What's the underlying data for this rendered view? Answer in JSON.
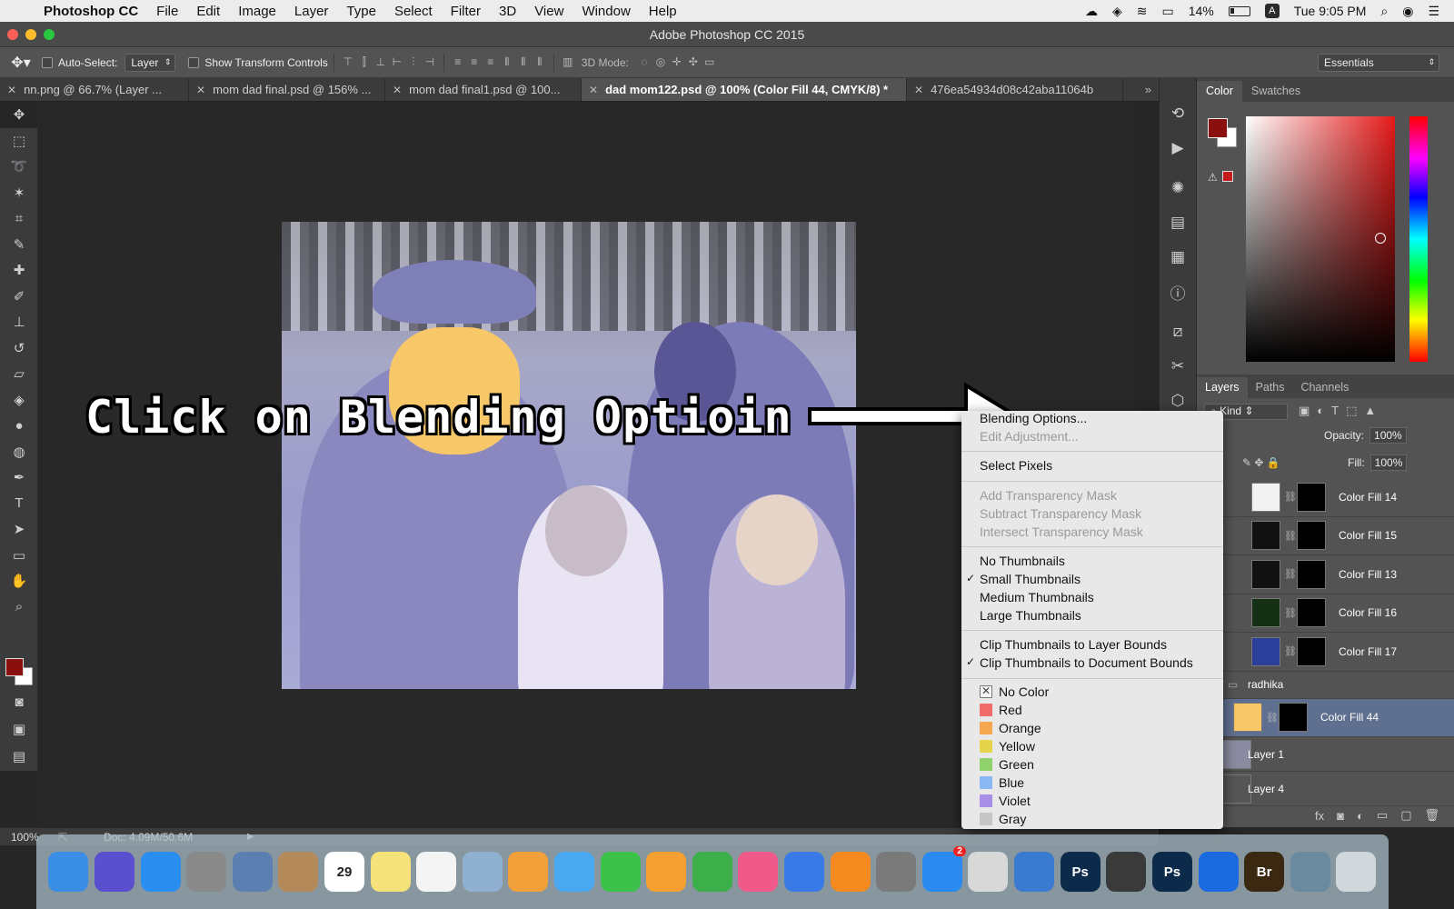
{
  "menubar": {
    "app_name": "Photoshop CC",
    "items": [
      "File",
      "Edit",
      "Image",
      "Layer",
      "Type",
      "Select",
      "Filter",
      "3D",
      "View",
      "Window",
      "Help"
    ],
    "battery": "14%",
    "input_source": "A",
    "clock": "Tue 9:05 PM"
  },
  "window": {
    "title": "Adobe Photoshop CC 2015"
  },
  "options": {
    "auto_select_label": "Auto-Select:",
    "auto_select_value": "Layer",
    "show_transform_label": "Show Transform Controls",
    "mode3d_label": "3D Mode:",
    "workspace": "Essentials"
  },
  "tabs": [
    {
      "label": "nn.png @ 66.7% (Layer ...",
      "active": false
    },
    {
      "label": "mom dad final.psd @ 156% ...",
      "active": false
    },
    {
      "label": "mom dad final1.psd @ 100...",
      "active": false
    },
    {
      "label": "dad mom122.psd @ 100% (Color Fill 44, CMYK/8) *",
      "active": true
    },
    {
      "label": "476ea54934d08c42aba11064b",
      "active": false
    }
  ],
  "annotation": {
    "text": "Click on Blending Optioin"
  },
  "status": {
    "zoom": "100%",
    "doc": "Doc: 4.09M/50.6M"
  },
  "color_panel": {
    "tabs": [
      "Color",
      "Swatches"
    ],
    "fg_color": "#8a1010",
    "bg_color": "#ffffff"
  },
  "layers_panel": {
    "tabs": [
      "Layers",
      "Paths",
      "Channels"
    ],
    "kind_label": "Kind",
    "opacity_label": "Opacity:",
    "opacity_value": "100%",
    "fill_label": "Fill:",
    "fill_value": "100%",
    "layers": [
      {
        "name": "Color Fill 14",
        "thumb": "#f2f2f2",
        "selected": false,
        "type": "fill"
      },
      {
        "name": "Color Fill 15",
        "thumb": "#111111",
        "selected": false,
        "type": "fill"
      },
      {
        "name": "Color Fill 13",
        "thumb": "#111111",
        "selected": false,
        "type": "fill"
      },
      {
        "name": "Color Fill 16",
        "thumb": "#163016",
        "selected": false,
        "type": "fill"
      },
      {
        "name": "Color Fill 17",
        "thumb": "#2c3f9a",
        "selected": false,
        "type": "fill"
      },
      {
        "name": "radhika",
        "thumb": "",
        "selected": false,
        "type": "group"
      },
      {
        "name": "Color Fill 44",
        "thumb": "#f7c768",
        "selected": true,
        "type": "fill"
      },
      {
        "name": "Layer 1",
        "thumb": "#8a8aa0",
        "selected": false,
        "type": "plain"
      },
      {
        "name": "Layer 4",
        "thumb": "#555555",
        "selected": false,
        "type": "plain"
      }
    ]
  },
  "context_menu": {
    "groups": [
      [
        {
          "label": "Blending Options...",
          "disabled": false
        },
        {
          "label": "Edit Adjustment...",
          "disabled": true
        }
      ],
      [
        {
          "label": "Select Pixels",
          "disabled": false
        }
      ],
      [
        {
          "label": "Add Transparency Mask",
          "disabled": true
        },
        {
          "label": "Subtract Transparency Mask",
          "disabled": true
        },
        {
          "label": "Intersect Transparency Mask",
          "disabled": true
        }
      ],
      [
        {
          "label": "No Thumbnails",
          "checked": false
        },
        {
          "label": "Small Thumbnails",
          "checked": true
        },
        {
          "label": "Medium Thumbnails",
          "checked": false
        },
        {
          "label": "Large Thumbnails",
          "checked": false
        }
      ],
      [
        {
          "label": "Clip Thumbnails to Layer Bounds",
          "checked": false
        },
        {
          "label": "Clip Thumbnails to Document Bounds",
          "checked": true
        }
      ]
    ],
    "colors": [
      {
        "label": "No Color",
        "color": "none"
      },
      {
        "label": "Red",
        "color": "#f26b6b"
      },
      {
        "label": "Orange",
        "color": "#f5a84f"
      },
      {
        "label": "Yellow",
        "color": "#e6d44a"
      },
      {
        "label": "Green",
        "color": "#8fd16a"
      },
      {
        "label": "Blue",
        "color": "#8ab6f2"
      },
      {
        "label": "Violet",
        "color": "#a98ee8"
      },
      {
        "label": "Gray",
        "color": "#c6c6c6"
      }
    ]
  },
  "dock": {
    "apps": [
      {
        "name": "finder-icon",
        "color": "#3a8ee6",
        "label": ""
      },
      {
        "name": "siri-icon",
        "color": "#5a4fcf",
        "label": ""
      },
      {
        "name": "safari-icon",
        "color": "#2a8ef0",
        "label": ""
      },
      {
        "name": "launchpad-icon",
        "color": "#8a8a8a",
        "label": ""
      },
      {
        "name": "image-capture-icon",
        "color": "#5a7fb0",
        "label": ""
      },
      {
        "name": "contacts-icon",
        "color": "#b48a5a",
        "label": ""
      },
      {
        "name": "calendar-icon",
        "color": "#ffffff",
        "label": "29"
      },
      {
        "name": "notes-icon",
        "color": "#f5e27a",
        "label": ""
      },
      {
        "name": "reminders-icon",
        "color": "#f4f4f4",
        "label": ""
      },
      {
        "name": "preview-icon",
        "color": "#8fb0d0",
        "label": ""
      },
      {
        "name": "photos-icon",
        "color": "#f2a03a",
        "label": ""
      },
      {
        "name": "messages-icon",
        "color": "#4aa8f0",
        "label": ""
      },
      {
        "name": "facetime-icon",
        "color": "#3cc24a",
        "label": ""
      },
      {
        "name": "pages-icon",
        "color": "#f5a030",
        "label": ""
      },
      {
        "name": "numbers-icon",
        "color": "#3cae4a",
        "label": ""
      },
      {
        "name": "itunes-icon",
        "color": "#f05a8a",
        "label": ""
      },
      {
        "name": "keynote-icon",
        "color": "#3a7ae6",
        "label": ""
      },
      {
        "name": "ibooks-icon",
        "color": "#f58a20",
        "label": ""
      },
      {
        "name": "system-preferences-icon",
        "color": "#7a7a7a",
        "label": ""
      },
      {
        "name": "app-store-icon",
        "color": "#2a8af0",
        "label": "",
        "badge": "2"
      },
      {
        "name": "script-editor-icon",
        "color": "#d8d8d8",
        "label": ""
      },
      {
        "name": "xcode-icon",
        "color": "#3a7ad0",
        "label": ""
      },
      {
        "name": "photoshop-icon",
        "color": "#0c2a4a",
        "label": "Ps"
      },
      {
        "name": "final-cut-icon",
        "color": "#3a3a3a",
        "label": ""
      },
      {
        "name": "photoshop-2-icon",
        "color": "#0c2a4a",
        "label": "Ps"
      },
      {
        "name": "teamviewer-icon",
        "color": "#1a6ae0",
        "label": ""
      },
      {
        "name": "bridge-icon",
        "color": "#3a2810",
        "label": "Br"
      },
      {
        "name": "preview-2-icon",
        "color": "#6a8aa0",
        "label": ""
      },
      {
        "name": "trash-icon",
        "color": "#d0d8dc",
        "label": ""
      }
    ]
  }
}
